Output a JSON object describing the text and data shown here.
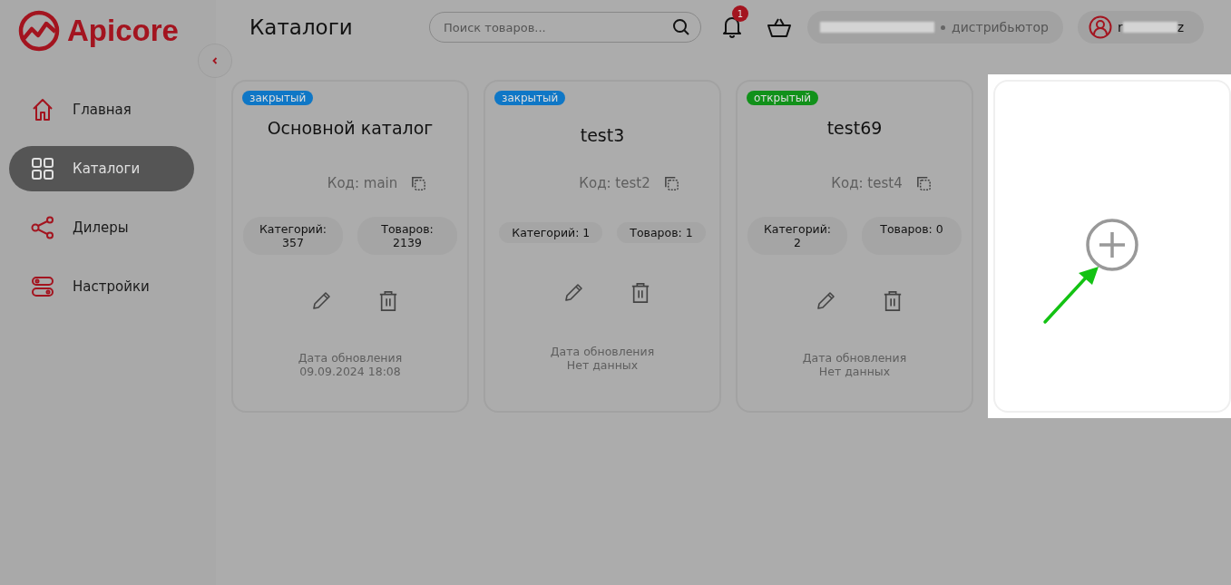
{
  "logo": {
    "text": "Apicore"
  },
  "nav": [
    {
      "label": "Главная",
      "selected": false
    },
    {
      "label": "Каталоги",
      "selected": true
    },
    {
      "label": "Дилеры",
      "selected": false
    },
    {
      "label": "Настройки",
      "selected": false
    }
  ],
  "header": {
    "title": "Каталоги",
    "search": {
      "placeholder": "Поиск товаров..."
    },
    "notifications": "1",
    "company": {
      "role": "дистрибьютор"
    },
    "user": {
      "name_start": "r",
      "name_end": "z"
    }
  },
  "catalogs": [
    {
      "status": "закрытый",
      "open": false,
      "compact": false,
      "title": "Основной каталог",
      "code": "Код: main",
      "stats": [
        "Категорий: 357",
        "Товаров: 2139"
      ],
      "updated_label": "Дата обновления",
      "updated": "09.09.2024 18:08"
    },
    {
      "status": "закрытый",
      "open": false,
      "compact": true,
      "title": "test3",
      "code": "Код: test2",
      "stats": [
        "Категорий: 1",
        "Товаров: 1"
      ],
      "updated_label": "Дата обновления",
      "updated": "Нет данных"
    },
    {
      "status": "открытый",
      "open": true,
      "compact": false,
      "title": "test69",
      "code": "Код: test4",
      "stats": [
        "Категорий: 2",
        "Товаров: 0"
      ],
      "updated_label": "Дата обновления",
      "updated": "Нет данных"
    }
  ]
}
